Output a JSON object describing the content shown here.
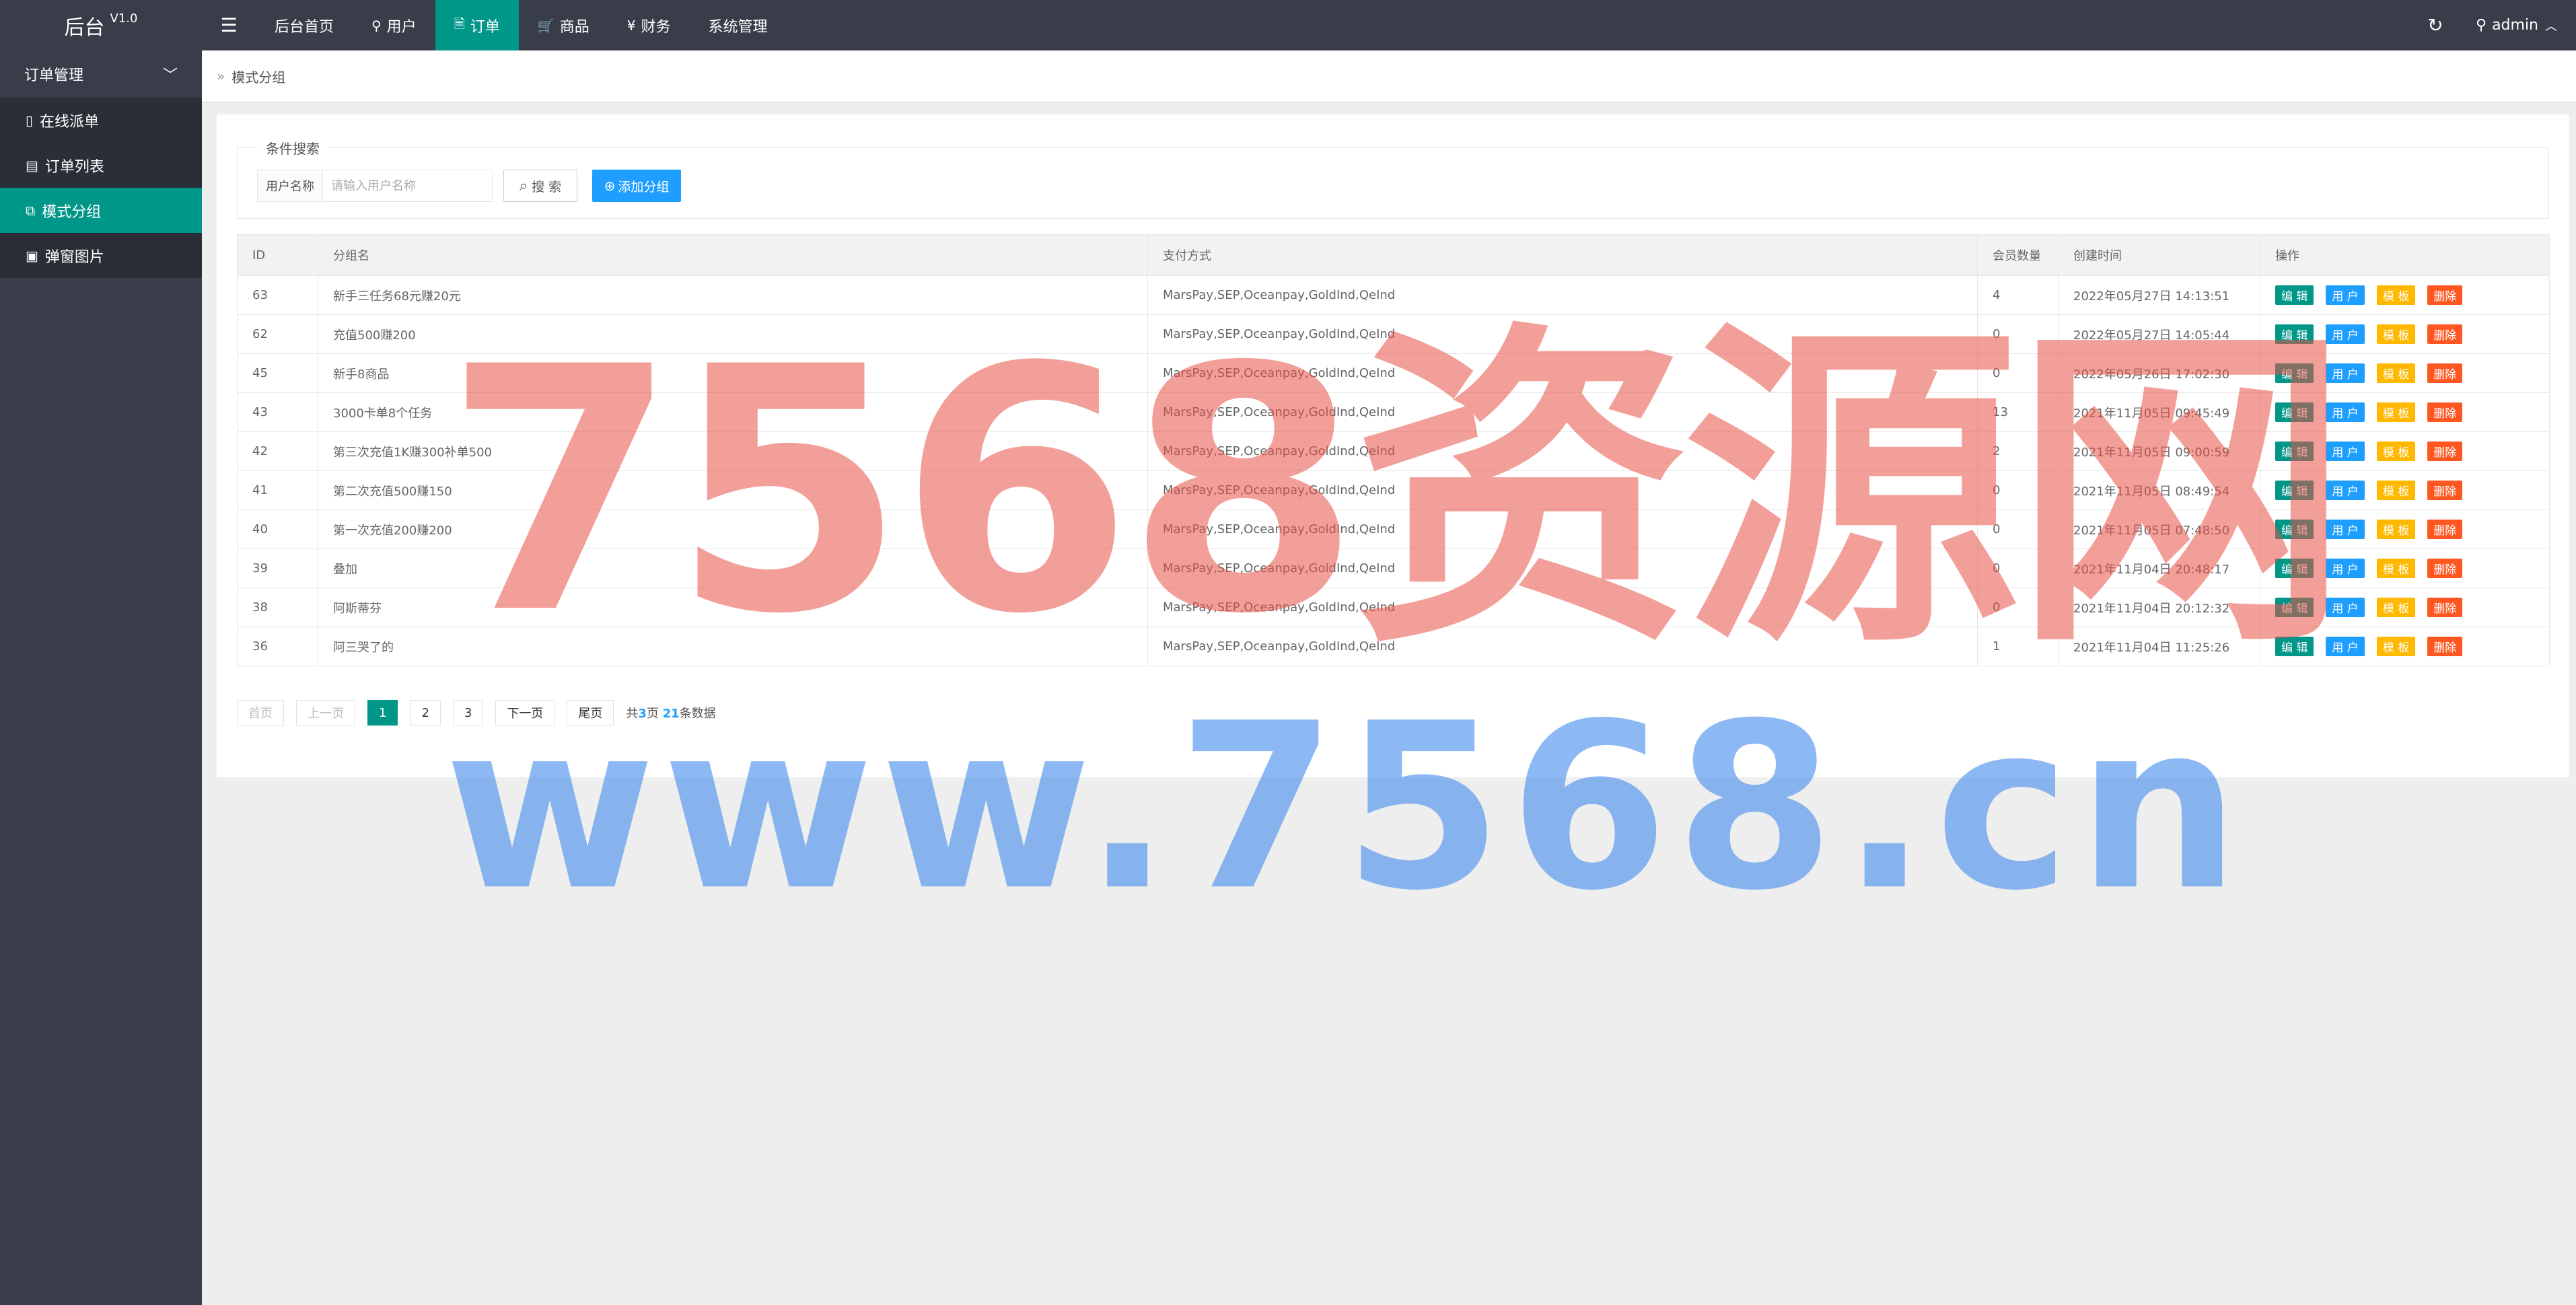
{
  "header": {
    "logo": "后台",
    "version": "V1.0",
    "nav": [
      {
        "label": "后台首页",
        "icon": ""
      },
      {
        "label": "用户",
        "icon": "user-icon"
      },
      {
        "label": "订单",
        "icon": "document-icon"
      },
      {
        "label": "商品",
        "icon": "cart-icon"
      },
      {
        "label": "财务",
        "icon": "yen-icon"
      },
      {
        "label": "系统管理",
        "icon": ""
      }
    ],
    "admin": "admin"
  },
  "sidebar": {
    "group": "订单管理",
    "items": [
      {
        "label": "在线派单",
        "icon": "note-icon"
      },
      {
        "label": "订单列表",
        "icon": "list-icon"
      },
      {
        "label": "模式分组",
        "icon": "group-icon"
      },
      {
        "label": "弹窗图片",
        "icon": "image-icon"
      }
    ]
  },
  "breadcrumb": "模式分组",
  "search": {
    "legend": "条件搜索",
    "label": "用户名称",
    "placeholder": "请输入用户名称",
    "search_button": "搜 索",
    "add_button": "添加分组"
  },
  "table": {
    "headers": [
      "ID",
      "分组名",
      "支付方式",
      "会员数量",
      "创建时间",
      "操作"
    ],
    "actions": {
      "edit": "编 辑",
      "user": "用 户",
      "template": "模 板",
      "delete": "删除"
    },
    "rows": [
      {
        "id": "63",
        "name": "新手三任务68元赚20元",
        "pay": "MarsPay,SEP,Oceanpay,GoldInd,QeInd",
        "count": "4",
        "time": "2022年05月27日 14:13:51"
      },
      {
        "id": "62",
        "name": "充值500赚200",
        "pay": "MarsPay,SEP,Oceanpay,GoldInd,QeInd",
        "count": "0",
        "time": "2022年05月27日 14:05:44"
      },
      {
        "id": "45",
        "name": "新手8商品",
        "pay": "MarsPay,SEP,Oceanpay,GoldInd,QeInd",
        "count": "0",
        "time": "2022年05月26日 17:02:30"
      },
      {
        "id": "43",
        "name": "3000卡单8个任务",
        "pay": "MarsPay,SEP,Oceanpay,GoldInd,QeInd",
        "count": "13",
        "time": "2021年11月05日 09:45:49"
      },
      {
        "id": "42",
        "name": "第三次充值1K赚300补单500",
        "pay": "MarsPay,SEP,Oceanpay,GoldInd,QeInd",
        "count": "2",
        "time": "2021年11月05日 09:00:59"
      },
      {
        "id": "41",
        "name": "第二次充值500赚150",
        "pay": "MarsPay,SEP,Oceanpay,GoldInd,QeInd",
        "count": "0",
        "time": "2021年11月05日 08:49:54"
      },
      {
        "id": "40",
        "name": "第一次充值200赚200",
        "pay": "MarsPay,SEP,Oceanpay,GoldInd,QeInd",
        "count": "0",
        "time": "2021年11月05日 07:48:50"
      },
      {
        "id": "39",
        "name": "叠加",
        "pay": "MarsPay,SEP,Oceanpay,GoldInd,QeInd",
        "count": "0",
        "time": "2021年11月04日 20:48:17"
      },
      {
        "id": "38",
        "name": "阿斯蒂芬",
        "pay": "MarsPay,SEP,Oceanpay,GoldInd,QeInd",
        "count": "0",
        "time": "2021年11月04日 20:12:32"
      },
      {
        "id": "36",
        "name": "阿三哭了的",
        "pay": "MarsPay,SEP,Oceanpay,GoldInd,QeInd",
        "count": "1",
        "time": "2021年11月04日 11:25:26"
      }
    ]
  },
  "pager": {
    "first": "首页",
    "prev": "上一页",
    "pages": [
      "1",
      "2",
      "3"
    ],
    "current": "1",
    "next": "下一页",
    "last": "尾页",
    "info_prefix": "共",
    "total_pages": "3",
    "info_mid": "页 ",
    "total_items": "21",
    "info_suffix": "条数据"
  },
  "watermark": {
    "line1": "7568资源网",
    "line2": "www.7568.cn"
  }
}
